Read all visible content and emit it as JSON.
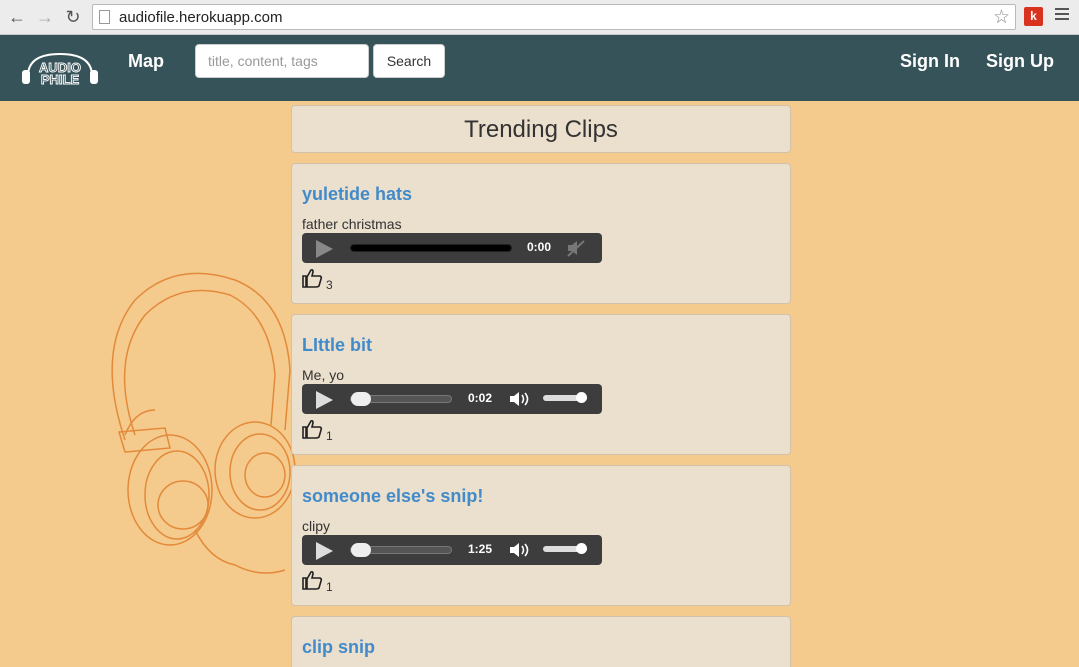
{
  "browser": {
    "url": "audiofile.herokuapp.com",
    "extension_label": "k"
  },
  "navbar": {
    "logo_top": "AUDIO",
    "logo_bottom": "PHILE",
    "map_label": "Map",
    "search_placeholder": "title, content, tags",
    "search_button": "Search",
    "sign_in": "Sign In",
    "sign_up": "Sign Up",
    "bg_color": "#36535a"
  },
  "page": {
    "title": "Trending Clips",
    "bg_color": "#f5ca8d"
  },
  "clips": [
    {
      "title": "yuletide hats",
      "description": "father christmas",
      "time": "0:00",
      "likes": "3",
      "player_state": "disabled-muted"
    },
    {
      "title": "LIttle bit",
      "description": "Me, yo",
      "time": "0:02",
      "likes": "1",
      "player_state": "ready"
    },
    {
      "title": "someone else's snip!",
      "description": "clipy",
      "time": "1:25",
      "likes": "1",
      "player_state": "ready"
    },
    {
      "title": "clip snip"
    }
  ]
}
